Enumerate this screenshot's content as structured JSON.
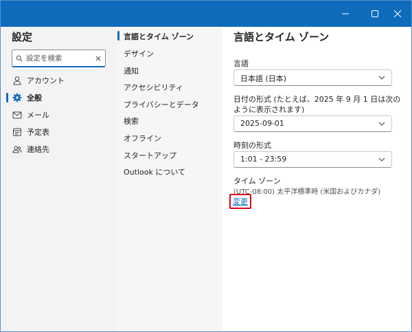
{
  "window": {
    "controls": [
      "minimize-icon",
      "maximize-icon",
      "close-icon"
    ],
    "accent": "#0f6cbd",
    "highlight": "#e0001b"
  },
  "nav": {
    "title": "設定",
    "search_placeholder": "設定を検索",
    "items": [
      {
        "label": "アカウント",
        "icon": "person-icon",
        "active": false
      },
      {
        "label": "全般",
        "icon": "gear-icon",
        "active": true
      },
      {
        "label": "メール",
        "icon": "mail-icon",
        "active": false
      },
      {
        "label": "予定表",
        "icon": "calendar-icon",
        "active": false
      },
      {
        "label": "連絡先",
        "icon": "people-icon",
        "active": false
      }
    ]
  },
  "subnav": {
    "items": [
      {
        "label": "言語とタイム ゾーン",
        "active": true
      },
      {
        "label": "デザイン",
        "active": false
      },
      {
        "label": "通知",
        "active": false
      },
      {
        "label": "アクセシビリティ",
        "active": false
      },
      {
        "label": "プライバシーとデータ",
        "active": false
      },
      {
        "label": "検索",
        "active": false
      },
      {
        "label": "オフライン",
        "active": false
      },
      {
        "label": "スタートアップ",
        "active": false
      },
      {
        "label": "Outlook について",
        "active": false
      }
    ]
  },
  "detail": {
    "title": "言語とタイム ゾーン",
    "language": {
      "label": "言語",
      "value": "日本語 (日本)"
    },
    "date_format": {
      "label_line1": "日付の形式 (たとえば、2025 年 9 月 1 日は次の",
      "label_line2": "ように表示されます)",
      "value": "2025-09-01"
    },
    "time_format": {
      "label": "時刻の形式",
      "value": "1:01 - 23:59"
    },
    "timezone": {
      "label": "タイム ゾーン",
      "value": "(UTC-08:00) 太平洋標準時 (米国およびカナダ)",
      "change_label": "変更"
    }
  }
}
